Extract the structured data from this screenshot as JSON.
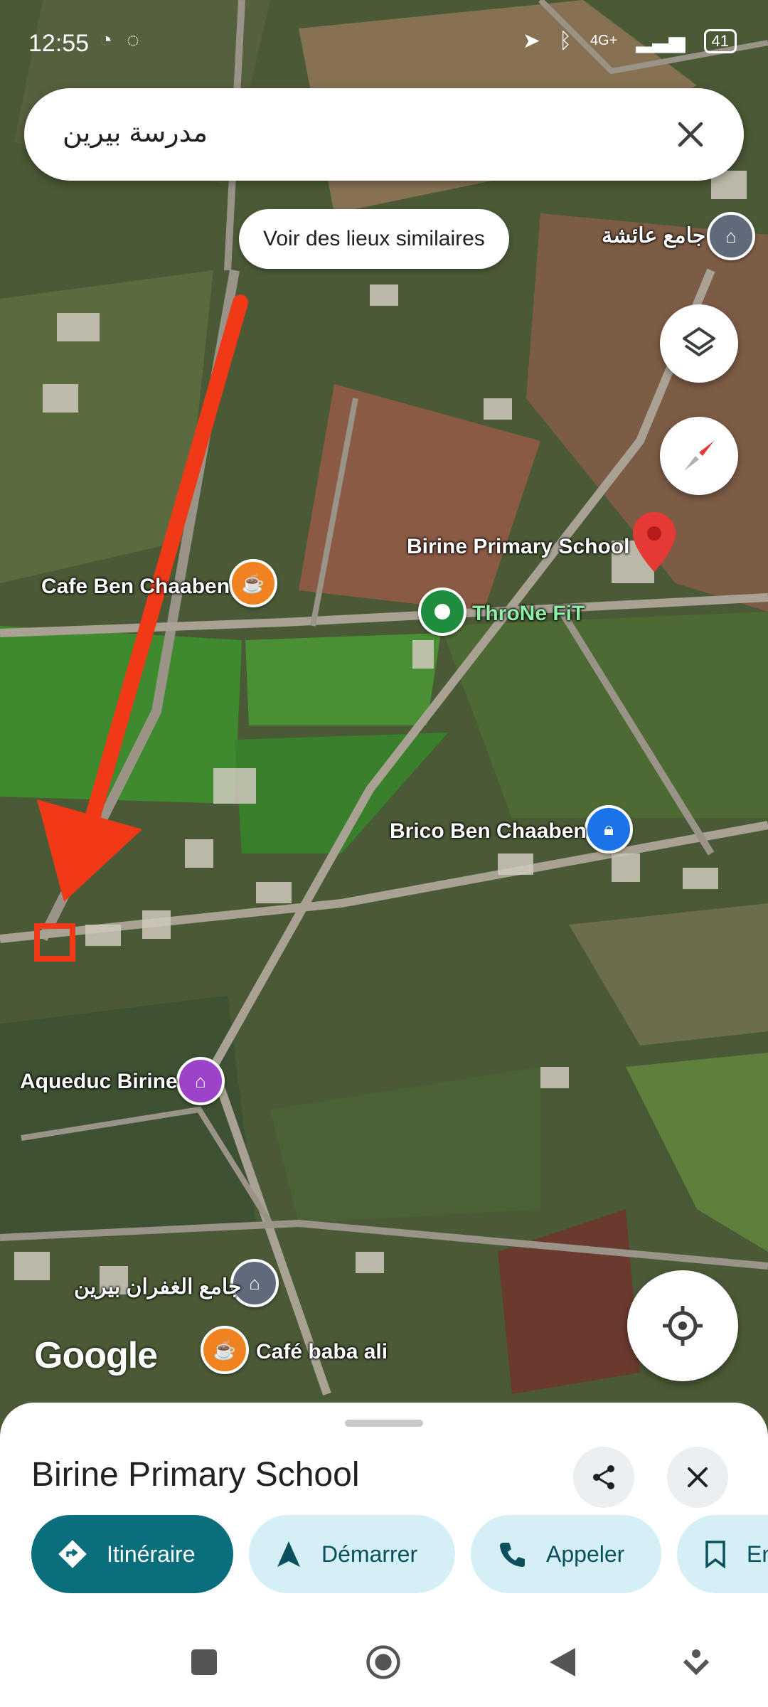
{
  "status_bar": {
    "time": "12:55",
    "network": "4G+",
    "battery": "41"
  },
  "search": {
    "query": "مدرسة بيرين"
  },
  "chip": {
    "label": "Voir des lieux similaires"
  },
  "map_labels": {
    "mosque_aicha": "جامع عائشة",
    "birine_school": "Birine Primary School",
    "cafe_ben_chaaben": "Cafe Ben Chaaben",
    "throne_fit": "ThroNe FiT",
    "brico": "Brico Ben Chaaben",
    "aqueduc": "Aqueduc Birine",
    "mosque_ghofrane": "جامع الغفران بيرين",
    "cafe_baba_ali": "Café baba ali"
  },
  "google_logo": "Google",
  "place_sheet": {
    "title": "Birine Primary School",
    "actions": {
      "directions": "Itinéraire",
      "start": "Démarrer",
      "call": "Appeler",
      "save": "En"
    }
  },
  "colors": {
    "primary_teal": "#0b6e7d",
    "light_teal": "#d4f0f6",
    "pin_red": "#e53935",
    "annotation_red": "#f03a17",
    "cafe_orange": "#f0831f",
    "gym_green": "#1e8e3e",
    "shop_blue": "#1a73e8",
    "museum_purple": "#9c43c9",
    "mosque_gray": "#5f6b7a"
  },
  "icons": [
    "messenger-icon",
    "location-arrow-icon",
    "bluetooth-icon",
    "signal-icon",
    "close-icon",
    "layers-icon",
    "compass-icon",
    "my-location-icon",
    "share-icon",
    "directions-icon",
    "navigation-icon",
    "phone-icon",
    "bookmark-icon",
    "square-icon",
    "home-circle-icon",
    "back-triangle-icon",
    "accessibility-icon"
  ]
}
